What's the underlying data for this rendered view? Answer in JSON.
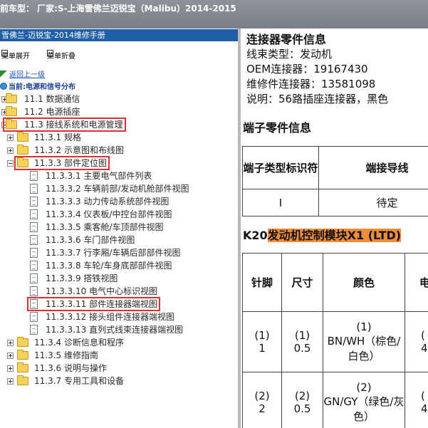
{
  "app": {
    "title_bar": "前车型： 厂家:S-上海雪佛兰迈锐宝（Malibu）2014-2015"
  },
  "left_panel": {
    "title": "雪佛兰-迈锐宝-2014维修手册",
    "toolbar": {
      "expand_label": "菜单展开",
      "collapse_label": "菜单折叠"
    },
    "back_label": "返回上一级",
    "current_label": "当前:电源和信号分布",
    "tree": [
      {
        "label": "11.1 数据通信",
        "type": "folder",
        "level": 0,
        "expanded": false
      },
      {
        "label": "11.2 电源插座",
        "type": "folder",
        "level": 0,
        "expanded": false
      },
      {
        "label": "11.3 接线系统和电源管理",
        "type": "folder",
        "level": 0,
        "expanded": true,
        "highlighted": true
      },
      {
        "label": "11.3.1 规格",
        "type": "folder",
        "level": 1,
        "expanded": false
      },
      {
        "label": "11.3.2 示意图和布线图",
        "type": "folder",
        "level": 1,
        "expanded": false
      },
      {
        "label": "11.3.3 部件定位图",
        "type": "folder",
        "level": 1,
        "expanded": true,
        "highlighted": true
      },
      {
        "label": "11.3.3.1 主要电气部件列表",
        "type": "doc",
        "level": 2
      },
      {
        "label": "11.3.3.2 车辆前部/发动机舱部件视图",
        "type": "doc",
        "level": 2
      },
      {
        "label": "11.3.3.3 动力传动系统部件视图",
        "type": "doc",
        "level": 2
      },
      {
        "label": "11.3.3.4 仪表板/中控台部件视图",
        "type": "doc",
        "level": 2
      },
      {
        "label": "11.3.3.5 乘客舱/车顶部件视图",
        "type": "doc",
        "level": 2
      },
      {
        "label": "11.3.3.6 车门部件视图",
        "type": "doc",
        "level": 2
      },
      {
        "label": "11.3.3.7 行李厢/车辆后部部件视图",
        "type": "doc",
        "level": 2
      },
      {
        "label": "11.3.3.8 车轮/车身底部部件视图",
        "type": "doc",
        "level": 2
      },
      {
        "label": "11.3.3.9 搭铁视图",
        "type": "doc",
        "level": 2
      },
      {
        "label": "11.3.3.10 电气中心标识视图",
        "type": "doc",
        "level": 2
      },
      {
        "label": "11.3.3.11 部件连接器端视图",
        "type": "doc",
        "level": 2,
        "highlighted": true
      },
      {
        "label": "11.3.3.12 接头组件连接器端视图",
        "type": "doc",
        "level": 2
      },
      {
        "label": "11.3.3.13 直列式线束连接器端视图",
        "type": "doc",
        "level": 2
      },
      {
        "label": "11.3.4 诊断信息和程序",
        "type": "folder",
        "level": 1,
        "expanded": false
      },
      {
        "label": "11.3.5 维修指南",
        "type": "folder",
        "level": 1,
        "expanded": false
      },
      {
        "label": "11.3.6 说明与操作",
        "type": "folder",
        "level": 1,
        "expanded": false
      },
      {
        "label": "11.3.7 专用工具和设备",
        "type": "folder",
        "level": 1,
        "expanded": false
      }
    ]
  },
  "right_panel": {
    "connector_section": {
      "title": "连接器零件信息",
      "lines": [
        "线束类型：发动机",
        "OEM连接器：19167430",
        "维修件连接器：13581098",
        "说明：56路插座连接器，黑色"
      ]
    },
    "terminal_section": {
      "title": "端子零件信息",
      "headers": [
        "端子类型标识符",
        "端接导线"
      ],
      "rows": [
        [
          "I",
          "待定"
        ]
      ]
    },
    "module_section": {
      "title_prefix": "K20",
      "title_highlight": "发动机控制模块X1 (LTD)",
      "headers": [
        "针脚",
        "尺寸",
        "颜色",
        "电路"
      ],
      "rows": [
        {
          "pin": "(1)\n1",
          "size": "(1)\n0.5",
          "color": "(1)\nBN/WH（棕色/白色）",
          "circuit": "(\n4"
        },
        {
          "pin": "(2)\n2",
          "size": "(2)\n0.5",
          "color": "(2)\nGN/GY（绿色/灰色）",
          "circuit": "(\n4"
        }
      ]
    }
  },
  "colors": {
    "panel_title_bg": "#1f5ea8",
    "highlight_border": "#e03030",
    "title_highlight_bg": "#f08c3a",
    "folder": "#f6d25a"
  }
}
